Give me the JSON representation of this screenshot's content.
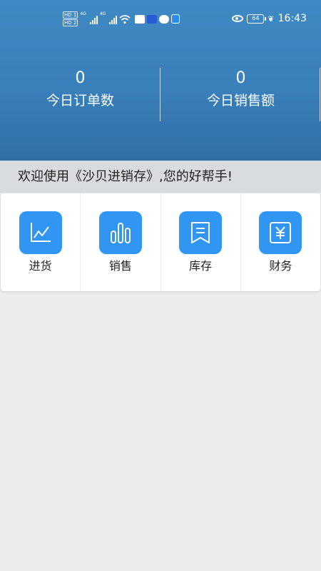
{
  "status_bar": {
    "hd1": "HD 1",
    "hd2": "HD 2",
    "net1": "4G",
    "net2": "4G",
    "battery": "64",
    "time": "16:43",
    "icons": [
      "signal-icon",
      "wifi-icon",
      "notification-icon",
      "chat-icon",
      "shield-icon",
      "eye-icon",
      "battery-icon",
      "leaf-icon"
    ]
  },
  "stats": [
    {
      "value": "0",
      "label": "今日订单数"
    },
    {
      "value": "0",
      "label": "今日销售额"
    }
  ],
  "welcome": "欢迎使用《沙贝进销存》,您的好帮手!",
  "menu": [
    {
      "label": "进货",
      "icon": "line-chart-icon"
    },
    {
      "label": "销售",
      "icon": "bar-chart-icon"
    },
    {
      "label": "库存",
      "icon": "inventory-icon"
    },
    {
      "label": "财务",
      "icon": "finance-icon"
    }
  ],
  "colors": {
    "header": "#3a80bb",
    "icon_bg": "#3196f3",
    "welcome_bg": "#d9dcdf",
    "page_bg": "#ececec"
  }
}
